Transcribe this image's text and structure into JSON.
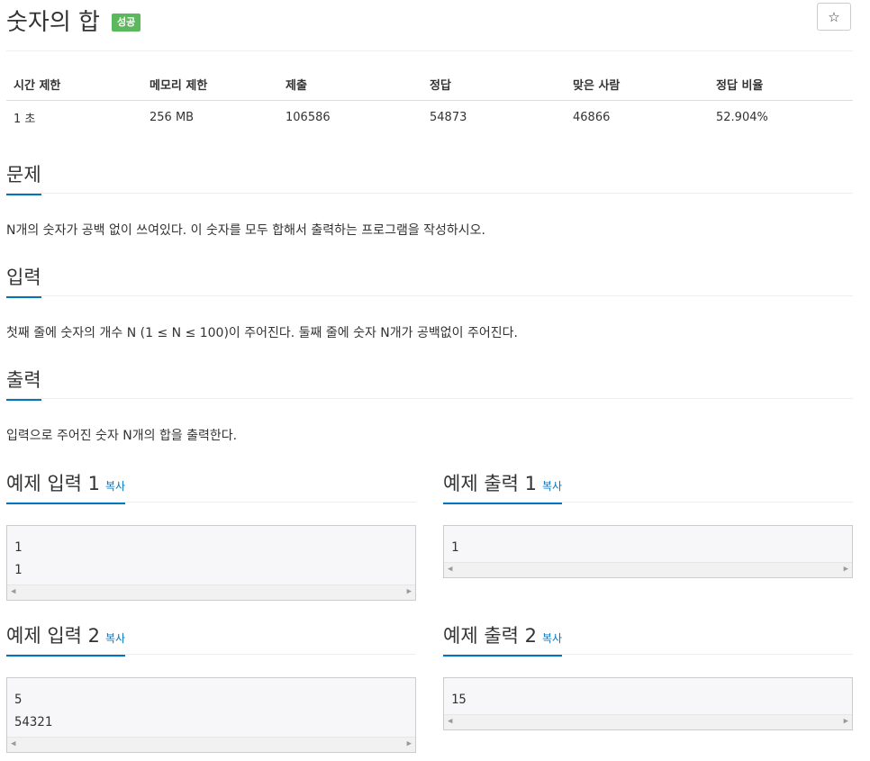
{
  "problem": {
    "title": "숫자의 합",
    "badge": "성공",
    "star_label": "☆"
  },
  "info": {
    "headers": [
      "시간 제한",
      "메모리 제한",
      "제출",
      "정답",
      "맞은 사람",
      "정답 비율"
    ],
    "values": [
      "1 초",
      "256 MB",
      "106586",
      "54873",
      "46866",
      "52.904%"
    ]
  },
  "sections": {
    "problem_title": "문제",
    "problem_text": "N개의 숫자가 공백 없이 쓰여있다. 이 숫자를 모두 합해서 출력하는 프로그램을 작성하시오.",
    "input_title": "입력",
    "input_text": "첫째 줄에 숫자의 개수 N (1 ≤ N ≤ 100)이 주어진다. 둘째 줄에 숫자 N개가 공백없이 주어진다.",
    "output_title": "출력",
    "output_text": "입력으로 주어진 숫자 N개의 합을 출력한다."
  },
  "samples": [
    {
      "input_title": "예제 입력 1",
      "output_title": "예제 출력 1",
      "copy": "복사",
      "input": "1\n1",
      "output": "1"
    },
    {
      "input_title": "예제 입력 2",
      "output_title": "예제 출력 2",
      "copy": "복사",
      "input": "5\n54321",
      "output": "15"
    }
  ],
  "colors": {
    "accent": "#0076c0",
    "success": "#5cb85c"
  }
}
